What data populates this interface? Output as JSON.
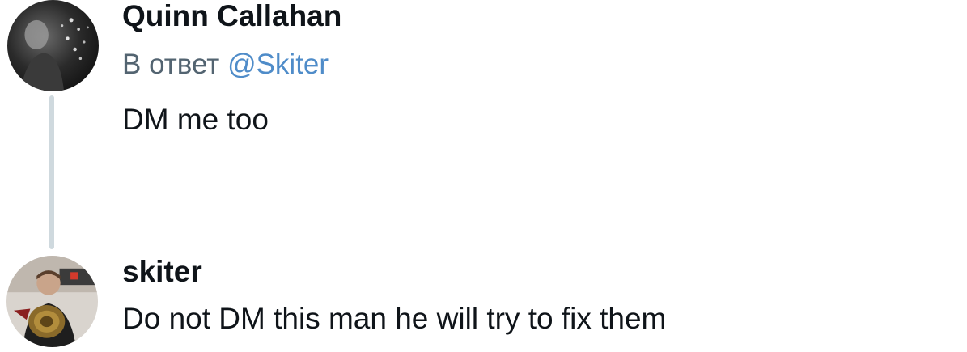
{
  "tweet_reply": {
    "author": "Quinn Callahan",
    "reply_prefix": "В ответ ",
    "mention": "@Skiter",
    "text": "DM me too"
  },
  "tweet_response": {
    "author": "skiter",
    "text": "Do not DM this man he will try to fix them"
  },
  "colors": {
    "mention": "#4f8cc9",
    "secondary_text": "#536471",
    "primary_text": "#0f1419",
    "thread_line": "#cfd9de"
  }
}
